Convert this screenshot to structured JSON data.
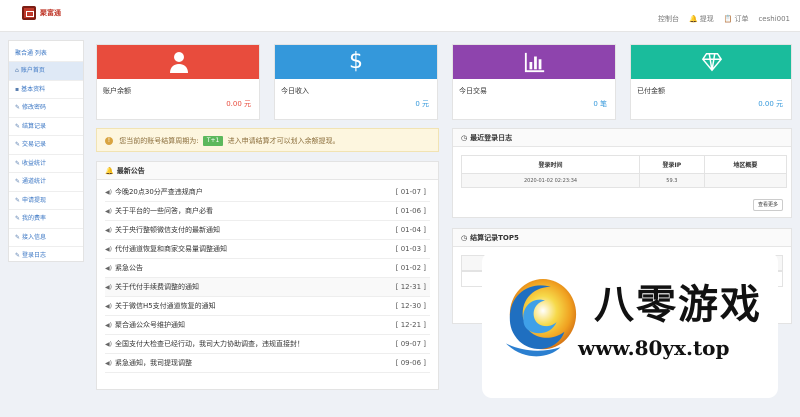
{
  "header": {
    "brand": "聚富通",
    "nav": [
      {
        "label": "控制台",
        "icon": ""
      },
      {
        "label": "提现",
        "icon": "bell-icon"
      },
      {
        "label": "订单",
        "icon": "clipboard-icon"
      },
      {
        "label": "ceshi001",
        "icon": ""
      }
    ]
  },
  "sidebar": {
    "title": "聚合通 列表",
    "items": [
      {
        "label": "账户首页",
        "active": true
      },
      {
        "label": "基本资料"
      },
      {
        "label": "修改密码"
      },
      {
        "label": "结算记录"
      },
      {
        "label": "交易记录"
      },
      {
        "label": "收益统计"
      },
      {
        "label": "通道统计"
      },
      {
        "label": "申请提现"
      },
      {
        "label": "我的费率"
      },
      {
        "label": "接入信息"
      },
      {
        "label": "登录日志"
      }
    ]
  },
  "cards": [
    {
      "label": "账户余额",
      "value": "0.00 元",
      "color": "#e84c3d",
      "value_color": "#e84c3d",
      "icon": "user-icon"
    },
    {
      "label": "今日收入",
      "value": "0 元",
      "color": "#3498db",
      "value_color": "#3498db",
      "icon": "dollar-icon"
    },
    {
      "label": "今日交易",
      "value": "0 笔",
      "color": "#8e44ad",
      "value_color": "#3498db",
      "icon": "bar-chart-icon"
    },
    {
      "label": "已付金额",
      "value": "0.00 元",
      "color": "#1abc9c",
      "value_color": "#3498db",
      "icon": "diamond-icon"
    }
  ],
  "notice": {
    "text_before": "您当前的账号结算周期为:",
    "tag": "T+1",
    "text_after": "进入申请结算才可以划入余额提现。"
  },
  "announcements": {
    "title": "最新公告",
    "items": [
      {
        "title": "今晚20点30分严查违规商户",
        "date": "[ 01-07 ]"
      },
      {
        "title": "关于平台的一些问答，商户必看",
        "date": "[ 01-06 ]"
      },
      {
        "title": "关于央行整顿微信支付的最新通知",
        "date": "[ 01-04 ]"
      },
      {
        "title": "代付通道恢复和商家交易量调整通知",
        "date": "[ 01-03 ]"
      },
      {
        "title": "紧急公告",
        "date": "[ 01-02 ]"
      },
      {
        "title": "关于代付手续费调整的通知",
        "date": "[ 12-31 ]"
      },
      {
        "title": "关于微信H5支付通道恢复的通知",
        "date": "[ 12-30 ]"
      },
      {
        "title": "聚合通公众号维护通知",
        "date": "[ 12-21 ]"
      },
      {
        "title": "全国支付大检查已经行动，我司大力协助调查，违规直接封！",
        "date": "[ 09-07 ]"
      },
      {
        "title": "紧急通知，我司提现调整",
        "date": "[ 09-06 ]"
      }
    ]
  },
  "login_log": {
    "title": "最近登录日志",
    "columns": [
      "登录时间",
      "登录IP",
      "地区概要"
    ],
    "rows": [
      [
        "2020-01-02 02:23:34",
        "59.3",
        ""
      ]
    ],
    "more_label": "查看更多"
  },
  "tops": {
    "title": "结算记录TOP5"
  },
  "watermark": {
    "title": "八零游戏",
    "url": "www.80yx.top"
  }
}
